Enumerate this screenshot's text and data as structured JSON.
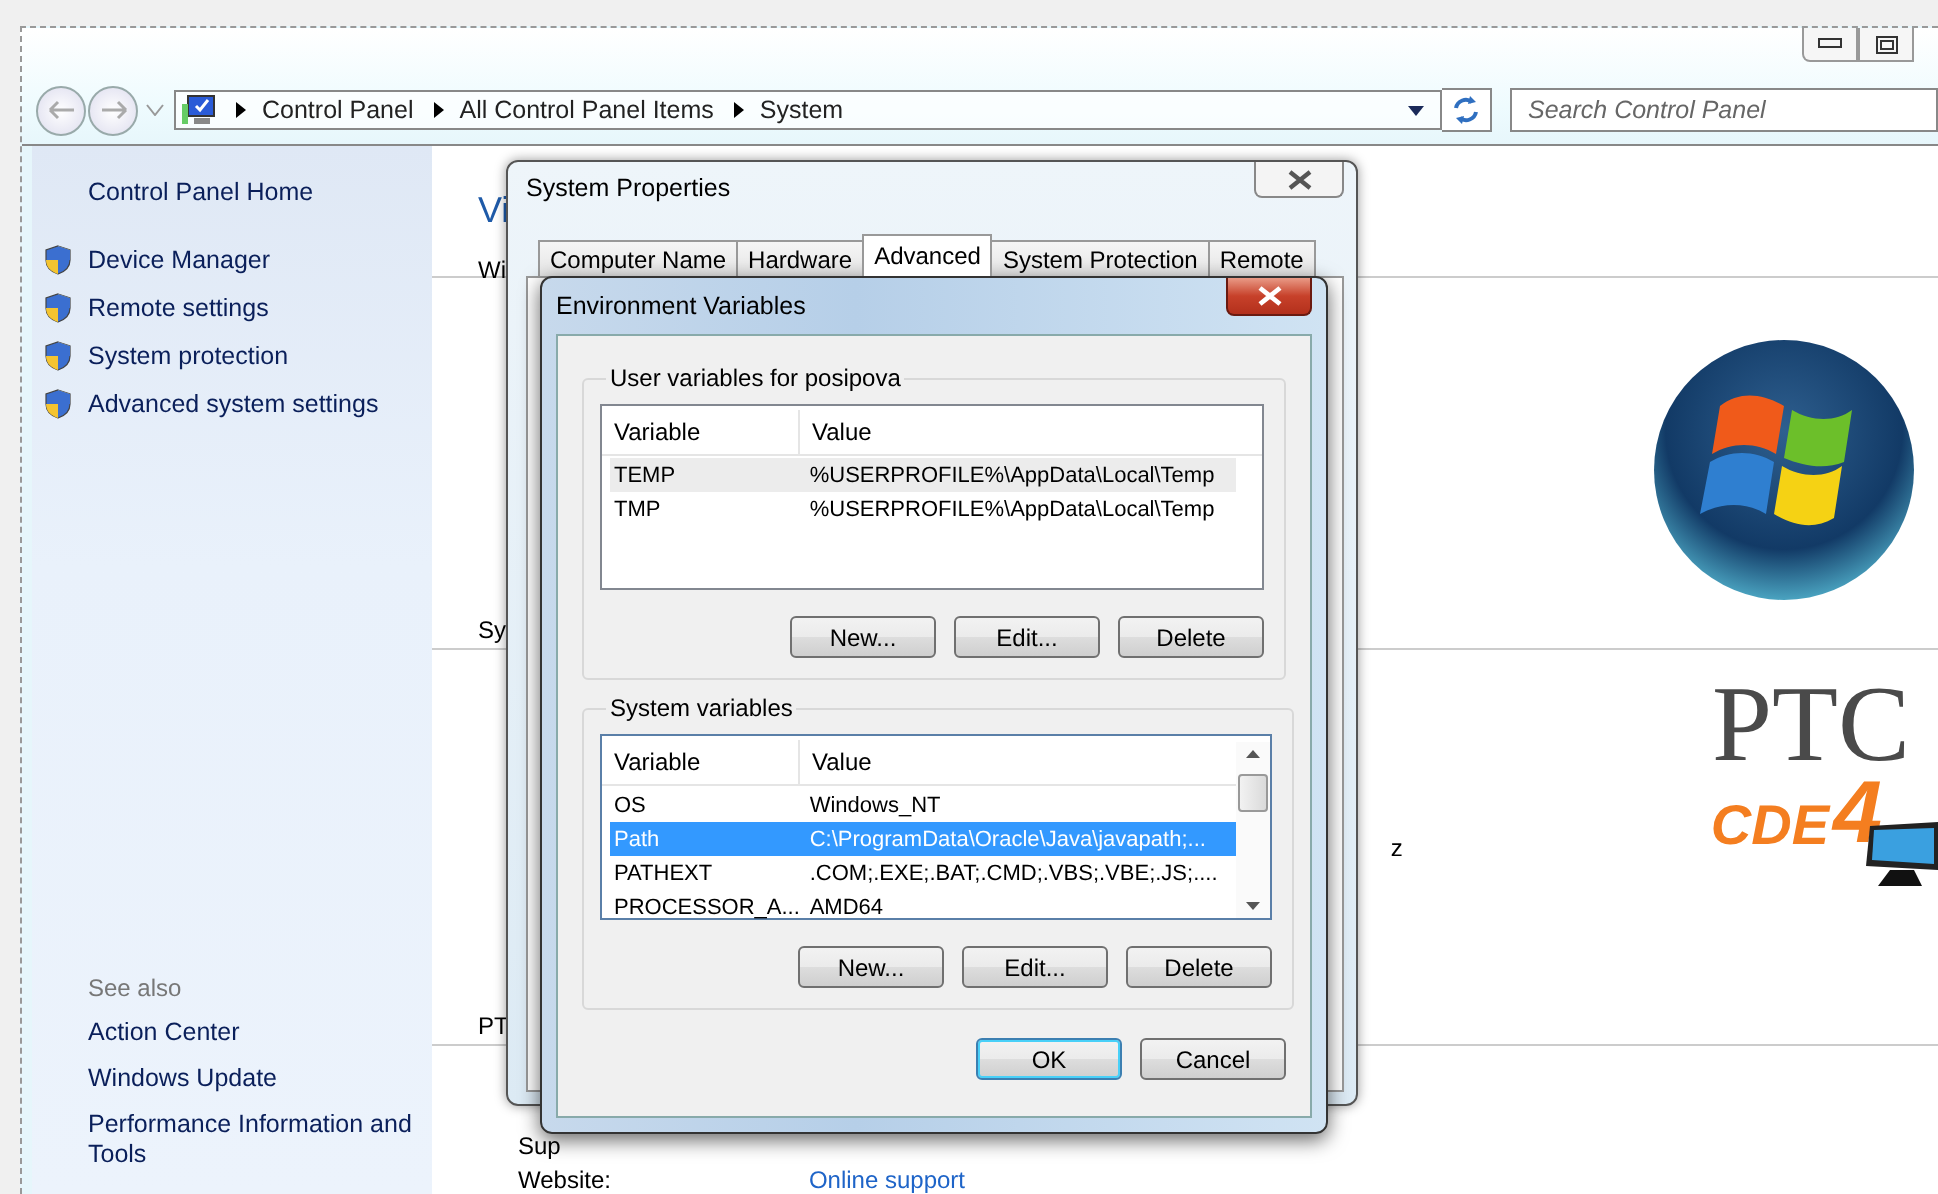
{
  "nav": {
    "breadcrumb": [
      "Control Panel",
      "All Control Panel Items",
      "System"
    ],
    "search": {
      "placeholder": "Search Control Panel"
    }
  },
  "sidebar": {
    "home": "Control Panel Home",
    "tasks": [
      "Device Manager",
      "Remote settings",
      "System protection",
      "Advanced system settings"
    ],
    "see_also_title": "See also",
    "see_also": [
      "Action Center",
      "Windows Update",
      "Performance Information and Tools"
    ]
  },
  "content": {
    "heading": "Vi",
    "line_1": "Wi",
    "line_2": "Sy",
    "line_3": "PT",
    "reading": "z",
    "support_label": "Sup",
    "website_label": "Website:",
    "website_link": "Online support",
    "logo_name": "PTC",
    "logo_product": "CDE",
    "logo_number": "4"
  },
  "system_properties": {
    "title": "System Properties",
    "tabs": [
      {
        "label": "Computer Name",
        "selected": false
      },
      {
        "label": "Hardware",
        "selected": false
      },
      {
        "label": "Advanced",
        "selected": true
      },
      {
        "label": "System Protection",
        "selected": false
      },
      {
        "label": "Remote",
        "selected": false
      }
    ]
  },
  "environment_variables": {
    "title": "Environment Variables",
    "groups": [
      {
        "title": "User variables for posipova",
        "focused": false,
        "columns": [
          "Variable",
          "Value"
        ],
        "rows": [
          {
            "variable": "TEMP",
            "value": "%USERPROFILE%\\AppData\\Local\\Temp",
            "selected": true
          },
          {
            "variable": "TMP",
            "value": "%USERPROFILE%\\AppData\\Local\\Temp",
            "selected": false
          }
        ],
        "buttons": [
          "New...",
          "Edit...",
          "Delete"
        ]
      },
      {
        "title": "System variables",
        "focused": true,
        "columns": [
          "Variable",
          "Value"
        ],
        "rows": [
          {
            "variable": "OS",
            "value": "Windows_NT",
            "selected": false
          },
          {
            "variable": "Path",
            "value": "C:\\ProgramData\\Oracle\\Java\\javapath;...",
            "selected": true
          },
          {
            "variable": "PATHEXT",
            "value": ".COM;.EXE;.BAT;.CMD;.VBS;.VBE;.JS;....",
            "selected": false
          },
          {
            "variable": "PROCESSOR_A...",
            "value": "AMD64",
            "selected": false
          }
        ],
        "buttons": [
          "New...",
          "Edit...",
          "Delete"
        ]
      }
    ],
    "buttons": [
      "OK",
      "Cancel"
    ]
  }
}
